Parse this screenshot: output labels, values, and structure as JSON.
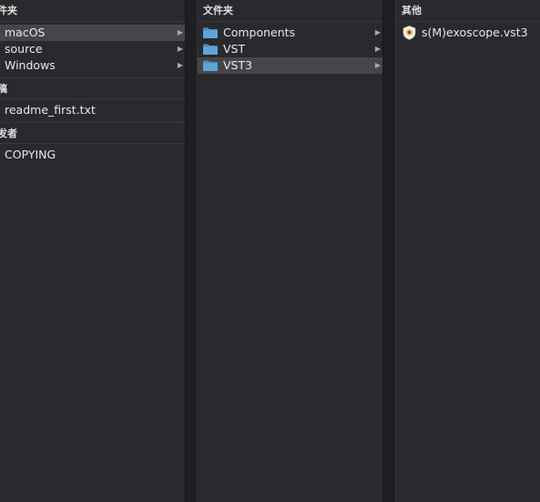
{
  "column1": {
    "folders_header": "件夹",
    "folders": [
      {
        "label": "macOS",
        "selected": true
      },
      {
        "label": "source",
        "selected": false
      },
      {
        "label": "Windows",
        "selected": false
      }
    ],
    "docs_header": "稿",
    "docs": [
      {
        "label": "readme_first.txt"
      }
    ],
    "other_header": "发者",
    "other": [
      {
        "label": "COPYING"
      }
    ]
  },
  "column2": {
    "header": "文件夹",
    "folders": [
      {
        "label": "Components",
        "selected": false
      },
      {
        "label": "VST",
        "selected": false
      },
      {
        "label": "VST3",
        "selected": true
      }
    ]
  },
  "column3": {
    "header": "其他",
    "items": [
      {
        "label": "s(M)exoscope.vst3",
        "icon": "vst3-plugin-icon"
      }
    ]
  },
  "colors": {
    "background": "#2a292d",
    "selection": "#46464a",
    "folder": "#5ba6d9",
    "text": "#e8e8e8"
  }
}
